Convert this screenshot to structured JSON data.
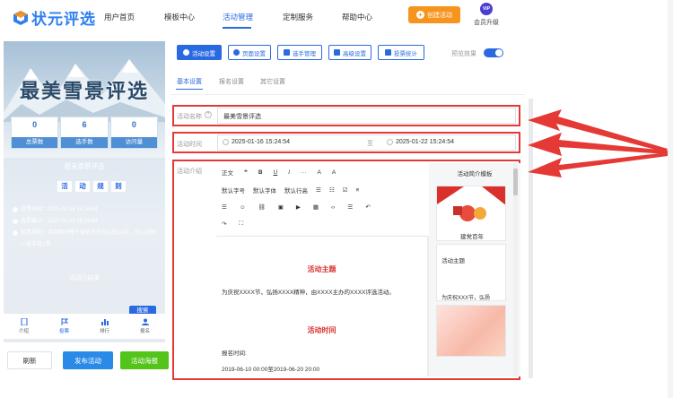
{
  "nav": {
    "logo": "状元评选",
    "items": [
      "用户首页",
      "模板中心",
      "活动管理",
      "定制服务",
      "帮助中心"
    ],
    "create_button": "创建活动",
    "vip_badge": "VIP",
    "vip_label": "会员升级"
  },
  "preview": {
    "title": "最美雪景评选",
    "stats": [
      {
        "value": "0",
        "label": "总票数"
      },
      {
        "value": "6",
        "label": "选手数"
      },
      {
        "value": "0",
        "label": "访问量"
      }
    ],
    "activity_name": "最美雪景评选",
    "tabs": [
      "活",
      "动",
      "规",
      "则"
    ],
    "rules": [
      "投票开始：2025-01-16 15:24:54",
      "投票截止：2025-01-22 15:24:54",
      "投票规则：活动期间每个微信号只可以投10次，可以对同一选手投1票"
    ],
    "ended_text": "活动已结束",
    "search_button": "搜索",
    "bottom_nav": [
      "介绍",
      "投票",
      "排行",
      "报名"
    ]
  },
  "actions": {
    "refresh": "刷新",
    "publish": "发布活动",
    "poster": "活动海报"
  },
  "settings_tabs": [
    "活动设置",
    "页面设置",
    "选手管理",
    "高级设置",
    "投票统计"
  ],
  "preview_toggle_label": "预览效果",
  "subtabs": [
    "基本设置",
    "报名设置",
    "其它设置"
  ],
  "form": {
    "name_label": "活动名称",
    "name_value": "最美雪景评选",
    "time_label": "活动时间",
    "start_time": "2025-01-16 15:24:54",
    "time_sep": "至",
    "end_time": "2025-01-22 15:24:54",
    "intro_label": "活动介绍"
  },
  "editor": {
    "toolbar_row1": [
      "正文",
      "❝",
      "B",
      "U",
      "I",
      "···",
      "A",
      "A"
    ],
    "toolbar_row2": [
      "默认字号",
      "默认字体",
      "默认行高",
      "☰",
      "☷",
      "☑",
      "≡"
    ],
    "heading1": "活动主题",
    "paragraph1": "为庆祝XXXX节，弘扬XXXX精神，由XXXX主办的XXXX评选活动。",
    "heading2": "活动时间",
    "paragraph2": "报名时间:",
    "paragraph3": "2019-06-10 00:00至2019-06-20 20:00"
  },
  "templates": {
    "title": "活动简介模板",
    "card1_text": "建党百年",
    "card2_title": "活动主题",
    "card2_text": "为庆祝XXX节，弘扬"
  },
  "colors": {
    "accent": "#2a6ae0",
    "orange": "#f7941d",
    "red_box": "#e53935",
    "green": "#52c41a"
  }
}
